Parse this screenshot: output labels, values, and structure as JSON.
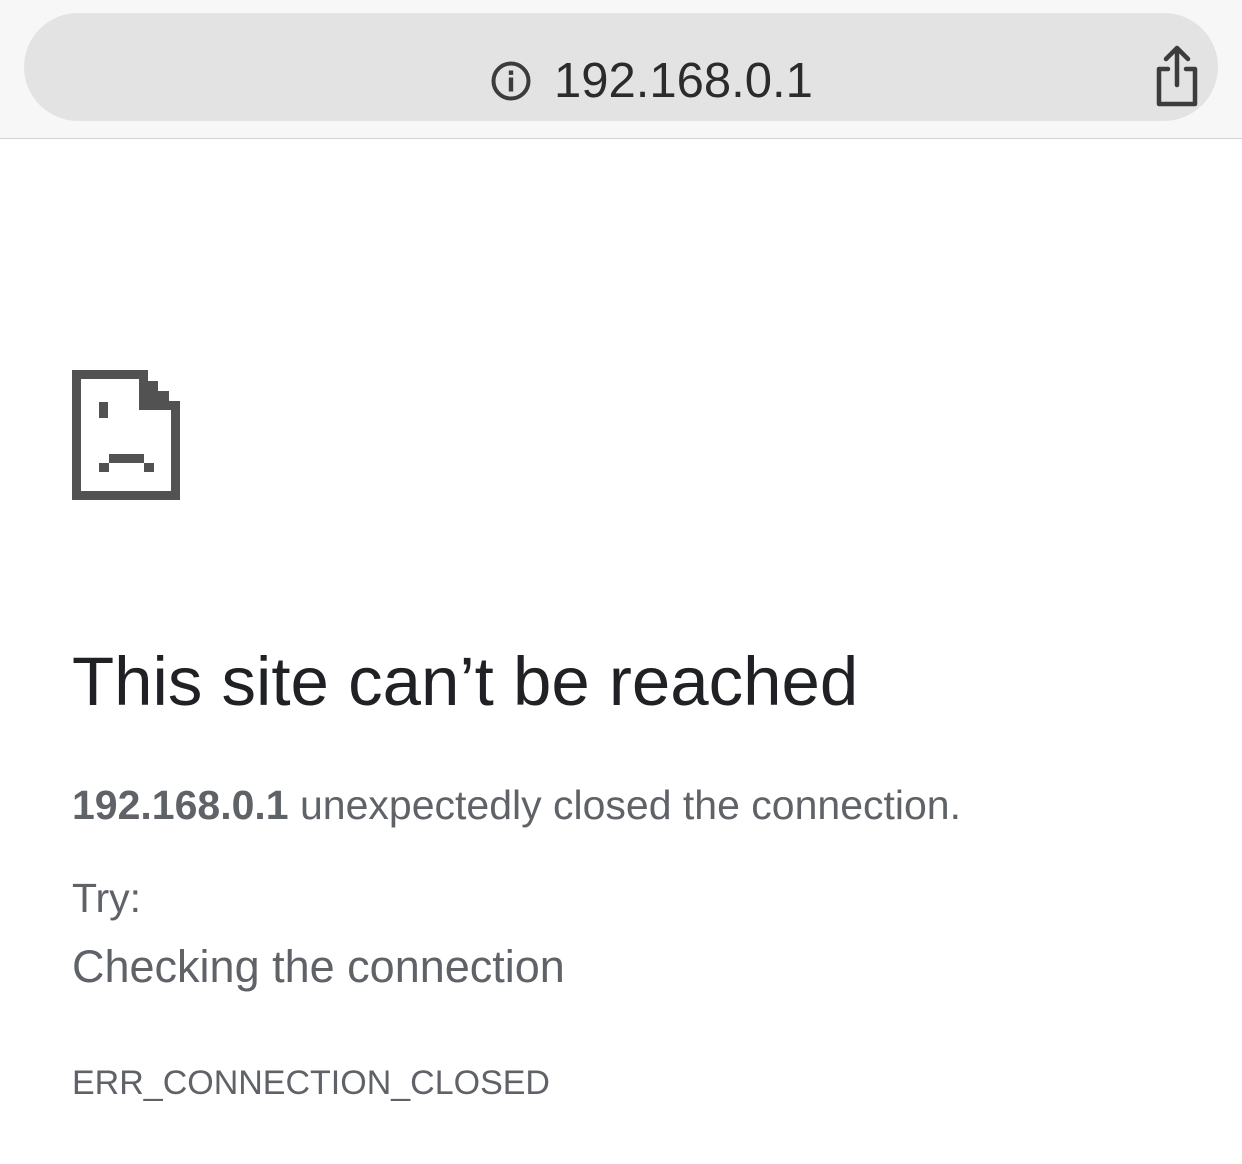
{
  "address_bar": {
    "url": "192.168.0.1",
    "info_icon": "info-circle-icon",
    "share_icon": "share-icon"
  },
  "error": {
    "icon": "sad-document-icon",
    "title": "This site can’t be reached",
    "host": "192.168.0.1",
    "message": " unexpectedly closed the connection.",
    "try_label": "Try:",
    "suggestions": [
      "Checking the connection"
    ],
    "code": "ERR_CONNECTION_CLOSED"
  },
  "colors": {
    "toolbar_bg": "#f7f7f7",
    "omnibox_bg": "#e3e3e3",
    "heading_text": "#202124",
    "body_text": "#5f6368",
    "icon_gray": "#525252"
  }
}
